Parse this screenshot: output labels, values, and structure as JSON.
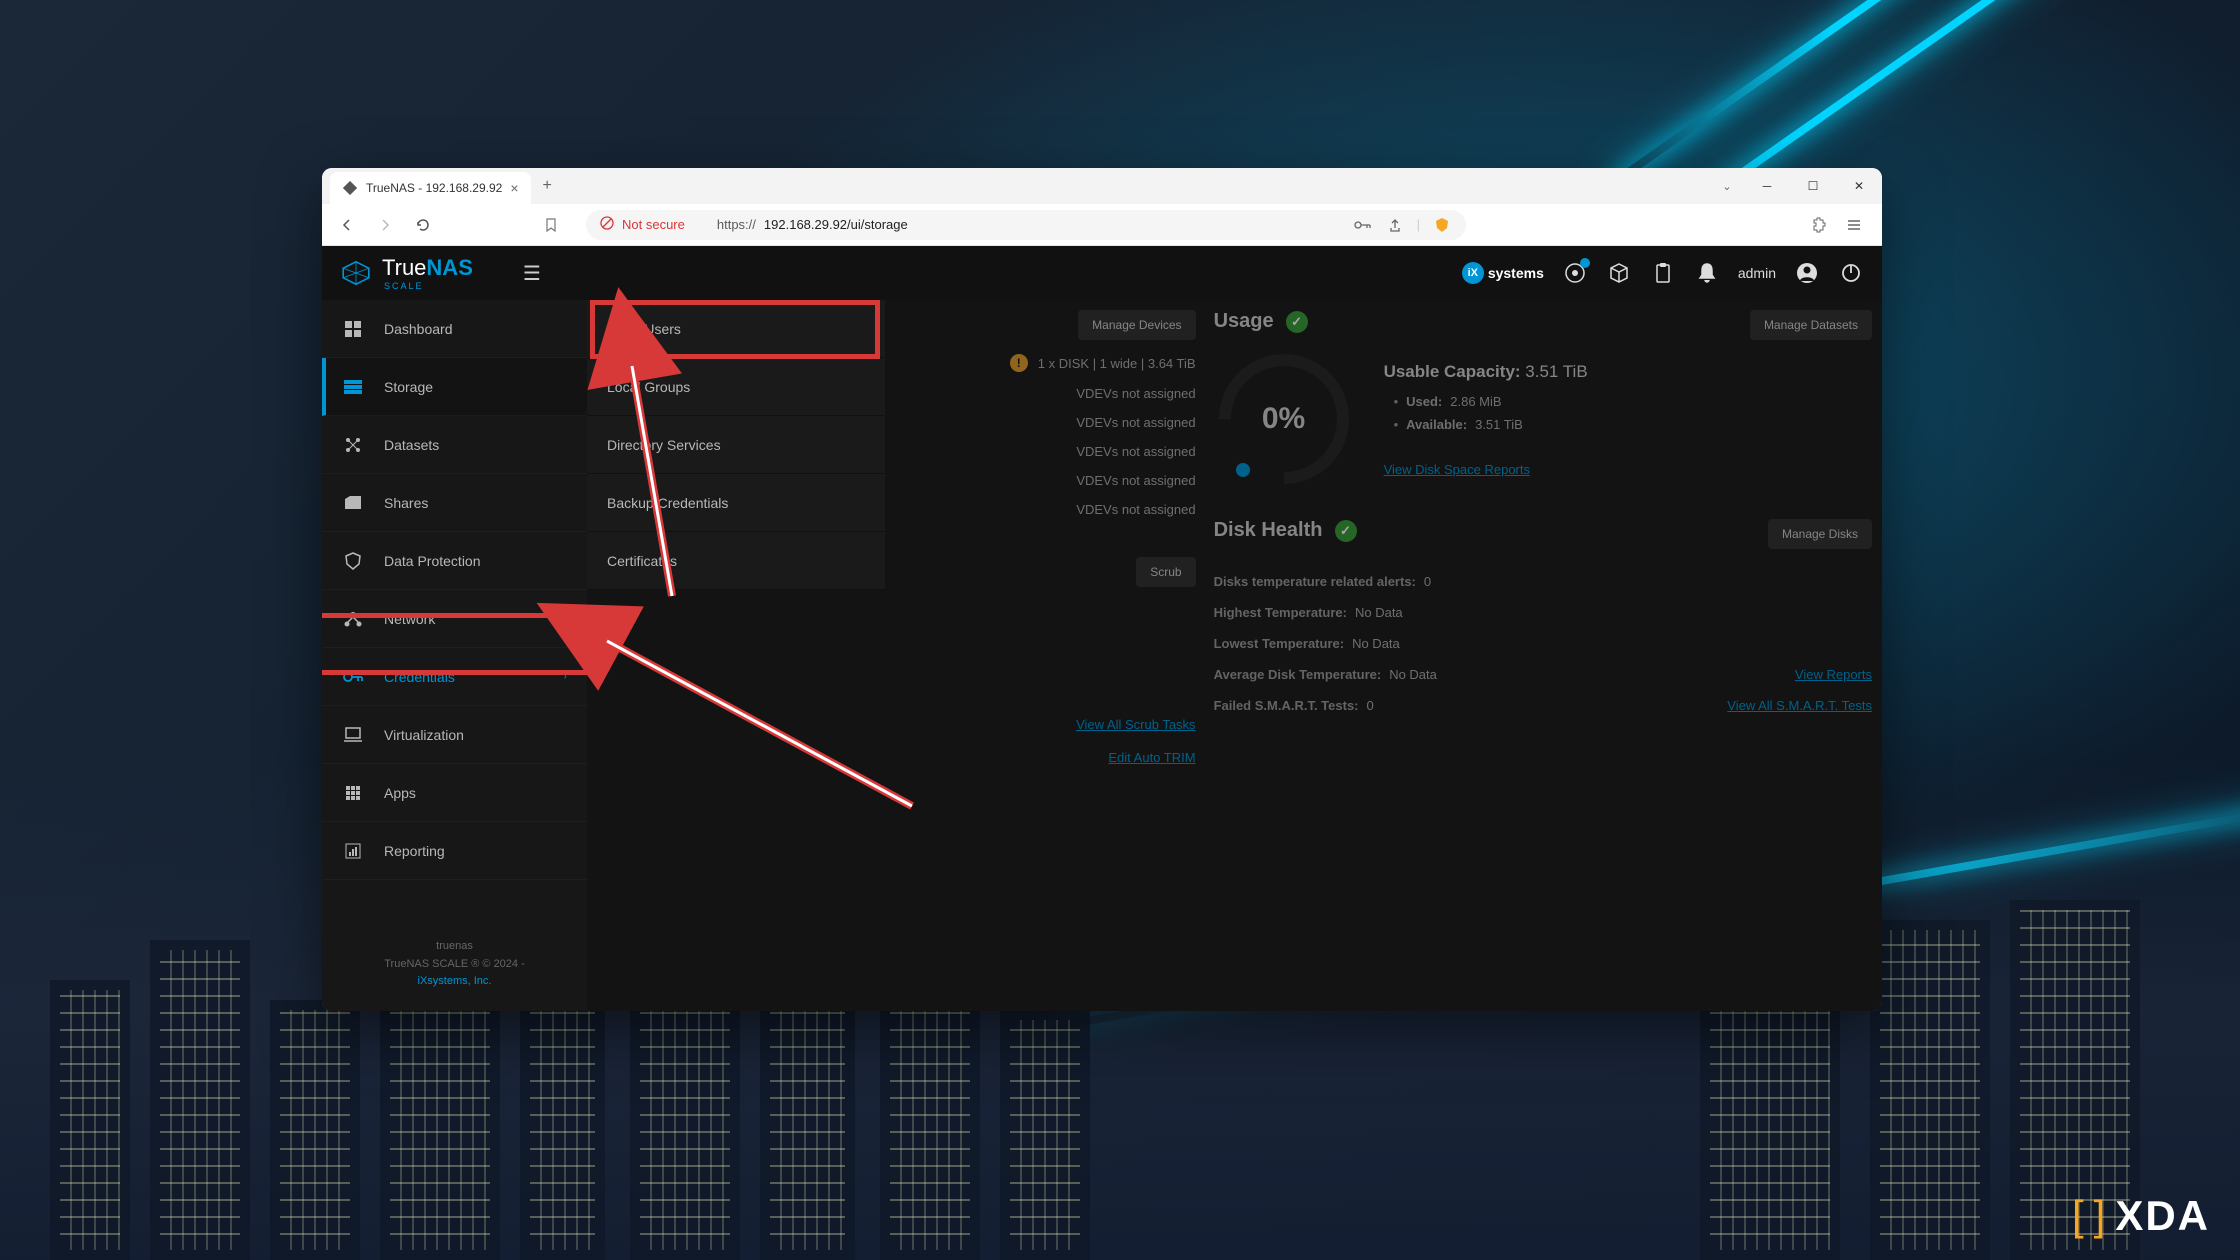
{
  "browser": {
    "tab_title": "TrueNAS - 192.168.29.92",
    "url_scheme": "https://",
    "url_host_path": "192.168.29.92/ui/storage",
    "not_secure": "Not secure"
  },
  "app": {
    "logo_true": "True",
    "logo_nas": "NAS",
    "logo_scale": "SCALE",
    "ix": "systems",
    "username": "admin"
  },
  "sidebar": {
    "dashboard": "Dashboard",
    "storage": "Storage",
    "datasets": "Datasets",
    "shares": "Shares",
    "data_protection": "Data Protection",
    "network": "Network",
    "credentials": "Credentials",
    "virtualization": "Virtualization",
    "apps": "Apps",
    "reporting": "Reporting",
    "footer_host": "truenas",
    "footer_ver": "TrueNAS SCALE ® © 2024 -",
    "footer_company": "iXsystems, Inc."
  },
  "submenu": {
    "local_users": "Local Users",
    "local_groups": "Local Groups",
    "directory_services": "Directory Services",
    "backup_credentials": "Backup Credentials",
    "certificates": "Certificates"
  },
  "content": {
    "manage_devices": "Manage Devices",
    "disk_info": "1 x DISK | 1 wide | 3.64 TiB",
    "vdev_na": "VDEVs not assigned",
    "scrub": "Scrub",
    "view_scrub": "View All Scrub Tasks",
    "edit_trim": "Edit Auto TRIM",
    "usage": "Usage",
    "manage_datasets": "Manage Datasets",
    "gauge_pct": "0%",
    "capacity_label": "Usable Capacity:",
    "capacity_val": "3.51 TiB",
    "used_label": "Used:",
    "used_val": "2.86 MiB",
    "avail_label": "Available:",
    "avail_val": "3.51 TiB",
    "view_disk_space": "View Disk Space Reports",
    "disk_health": "Disk Health",
    "manage_disks": "Manage Disks",
    "temp_alerts_label": "Disks temperature related alerts:",
    "temp_alerts_val": "0",
    "highest_temp_label": "Highest Temperature:",
    "no_data": "No Data",
    "lowest_temp_label": "Lowest Temperature:",
    "avg_temp_label": "Average Disk Temperature:",
    "failed_smart_label": "Failed S.M.A.R.T. Tests:",
    "failed_smart_val": "0",
    "view_reports": "View Reports",
    "view_smart": "View All S.M.A.R.T. Tests"
  },
  "watermark": "XDA"
}
